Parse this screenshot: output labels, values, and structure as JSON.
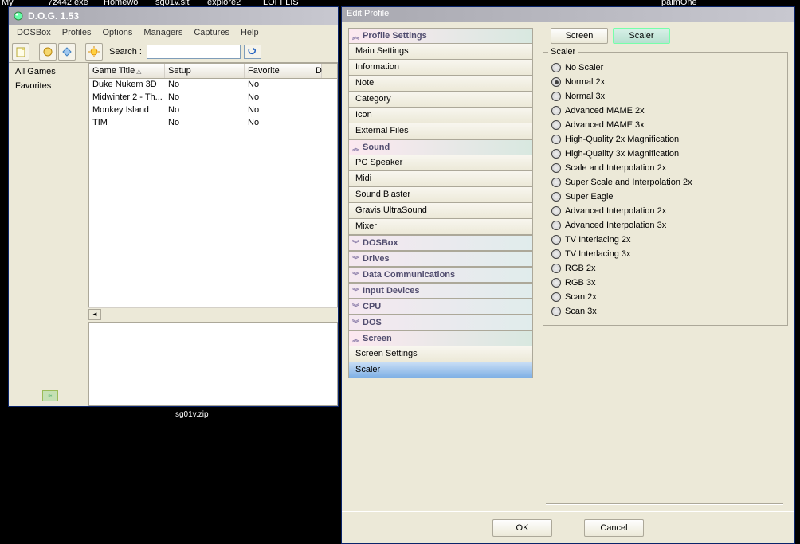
{
  "taskbar": {
    "items": [
      "My",
      "7z442.exe",
      "Homewo",
      "sg01v.sit",
      "explore2",
      "LOFFLIS",
      "palmOne"
    ]
  },
  "main_window": {
    "title": "D.O.G. 1.53",
    "menu": [
      "DOSBox",
      "Profiles",
      "Options",
      "Managers",
      "Captures",
      "Help"
    ],
    "search_label": "Search :",
    "sidebar": {
      "items": [
        "All Games",
        "Favorites"
      ]
    },
    "table": {
      "columns": [
        "Game Title",
        "Setup",
        "Favorite"
      ],
      "rows": [
        {
          "title": "Duke Nukem 3D",
          "setup": "No",
          "favorite": "No"
        },
        {
          "title": "Midwinter 2 - Th...",
          "setup": "No",
          "favorite": "No"
        },
        {
          "title": "Monkey Island",
          "setup": "No",
          "favorite": "No"
        },
        {
          "title": "TIM",
          "setup": "No",
          "favorite": "No"
        }
      ]
    }
  },
  "dialog": {
    "title": "Edit Profile",
    "sections": [
      {
        "label": "Profile Settings",
        "expanded": true,
        "items": [
          "Main Settings",
          "Information",
          "Note",
          "Category",
          "Icon",
          "External Files"
        ]
      },
      {
        "label": "Sound",
        "expanded": true,
        "items": [
          "PC Speaker",
          "Midi",
          "Sound Blaster",
          "Gravis UltraSound",
          "Mixer"
        ]
      },
      {
        "label": "DOSBox",
        "expanded": false,
        "items": []
      },
      {
        "label": "Drives",
        "expanded": false,
        "items": []
      },
      {
        "label": "Data Communications",
        "expanded": false,
        "items": []
      },
      {
        "label": "Input Devices",
        "expanded": false,
        "items": []
      },
      {
        "label": "CPU",
        "expanded": false,
        "items": []
      },
      {
        "label": "DOS",
        "expanded": false,
        "items": []
      },
      {
        "label": "Screen",
        "expanded": true,
        "items": [
          "Screen Settings",
          "Scaler"
        ]
      }
    ],
    "selected_item": "Scaler",
    "tabs": [
      "Screen",
      "Scaler"
    ],
    "active_tab": "Scaler",
    "group_label": "Scaler",
    "radios": [
      "No Scaler",
      "Normal 2x",
      "Normal 3x",
      "Advanced MAME 2x",
      "Advanced MAME 3x",
      "High-Quality 2x Magnification",
      "High-Quality 3x Magnification",
      "Scale and Interpolation 2x",
      "Super Scale and Interpolation 2x",
      "Super Eagle",
      "Advanced Interpolation 2x",
      "Advanced Interpolation 3x",
      "TV Interlacing 2x",
      "TV Interlacing 3x",
      "RGB 2x",
      "RGB 3x",
      "Scan 2x",
      "Scan 3x"
    ],
    "selected_radio": "Normal 2x",
    "ok_label": "OK",
    "cancel_label": "Cancel"
  },
  "bottom_text": "sg01v.zip"
}
